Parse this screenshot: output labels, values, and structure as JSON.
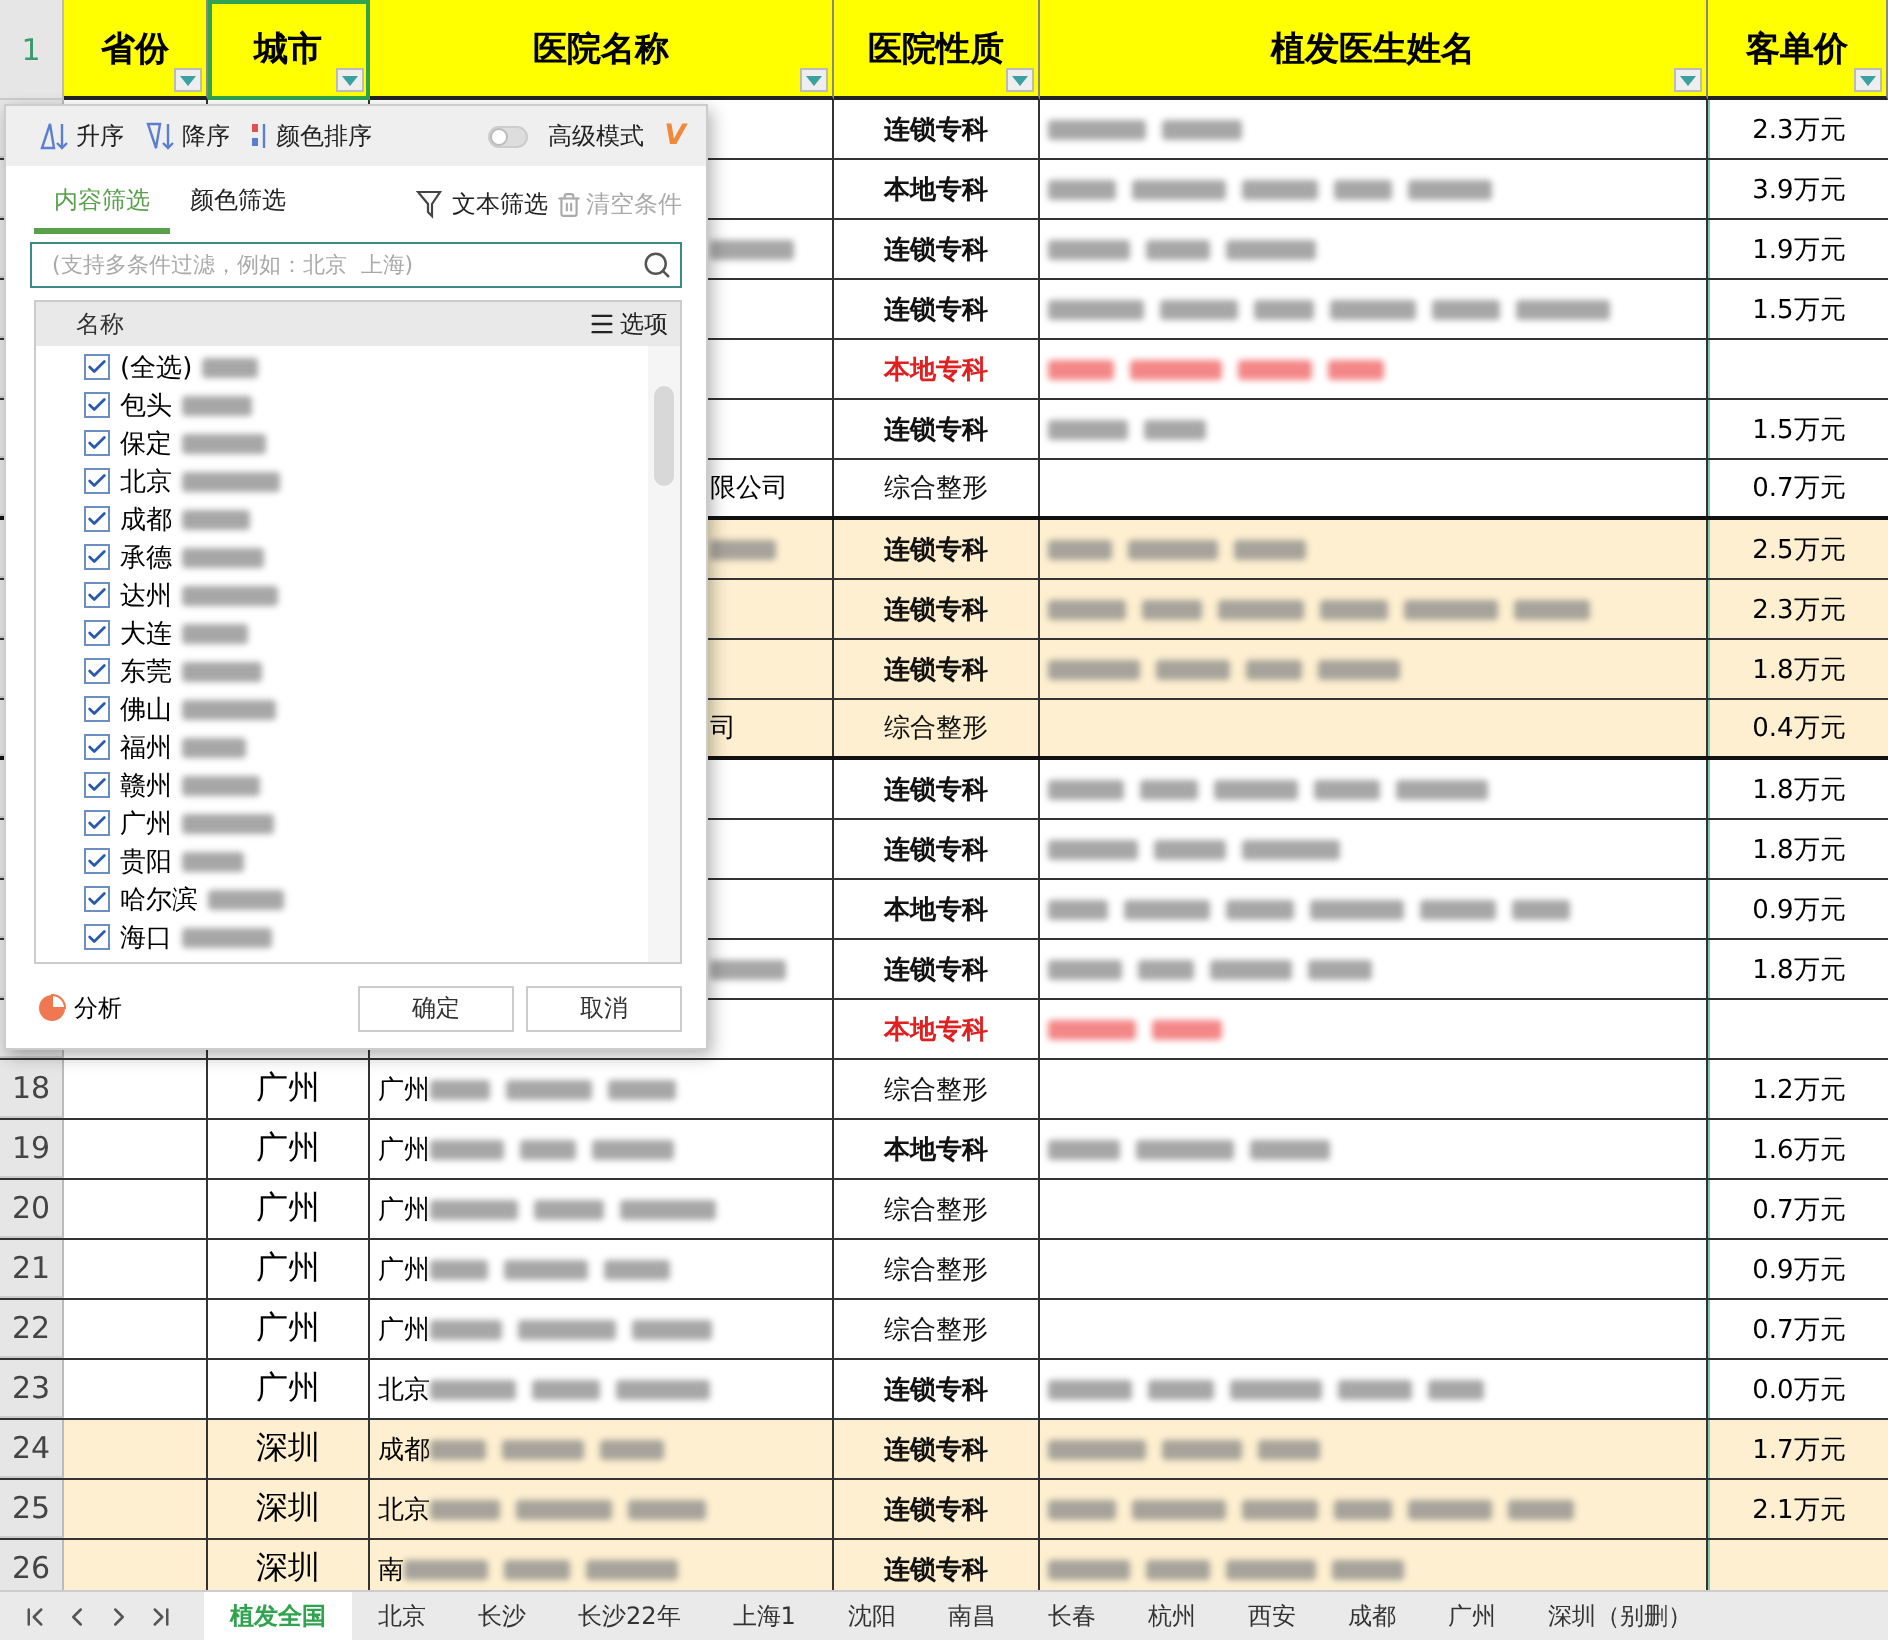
{
  "sheet": {
    "header_row": "1",
    "columns": [
      {
        "label": "省份",
        "selected": false
      },
      {
        "label": "城市",
        "selected": true
      },
      {
        "label": "医院名称",
        "selected": false
      },
      {
        "label": "医院性质",
        "selected": false
      },
      {
        "label": "植发医生姓名",
        "selected": false
      },
      {
        "label": "客单价",
        "selected": false
      }
    ],
    "rows": [
      {
        "nature": "连锁专科",
        "bold": true,
        "alert": false,
        "doctors_blurred": true,
        "price": "2.3万元",
        "shaded": false,
        "group_end": false
      },
      {
        "nature": "本地专科",
        "bold": true,
        "alert": false,
        "doctors_blurred": true,
        "price": "3.9万元",
        "shaded": false,
        "group_end": false
      },
      {
        "hospital_blurred": true,
        "nature": "连锁专科",
        "bold": true,
        "alert": false,
        "doctors_blurred": true,
        "price": "1.9万元",
        "shaded": false,
        "group_end": false
      },
      {
        "nature": "连锁专科",
        "bold": true,
        "alert": false,
        "doctors_blurred": true,
        "price": "1.5万元",
        "shaded": false,
        "group_end": false
      },
      {
        "nature": "本地专科",
        "bold": true,
        "alert": true,
        "doctors_blurred": true,
        "shaded": false,
        "group_end": false
      },
      {
        "nature": "连锁专科",
        "bold": true,
        "alert": false,
        "doctors_blurred": true,
        "price": "1.5万元",
        "shaded": false,
        "group_end": false
      },
      {
        "hospital": "限公司",
        "nature": "综合整形",
        "bold": false,
        "alert": false,
        "doctors_blurred": false,
        "price": "0.7万元",
        "shaded": false,
        "group_end": true
      },
      {
        "hospital_blurred": true,
        "nature": "连锁专科",
        "bold": true,
        "alert": false,
        "doctors_blurred": true,
        "price": "2.5万元",
        "shaded": true,
        "group_end": false
      },
      {
        "nature": "连锁专科",
        "bold": true,
        "alert": false,
        "doctors_blurred": true,
        "price": "2.3万元",
        "shaded": true,
        "group_end": false
      },
      {
        "nature": "连锁专科",
        "bold": true,
        "alert": false,
        "doctors_blurred": true,
        "price": "1.8万元",
        "shaded": true,
        "group_end": false
      },
      {
        "hospital": "司",
        "nature": "综合整形",
        "bold": false,
        "alert": false,
        "doctors_blurred": false,
        "price": "0.4万元",
        "shaded": true,
        "group_end": true
      },
      {
        "nature": "连锁专科",
        "bold": true,
        "alert": false,
        "doctors_blurred": true,
        "price": "1.8万元",
        "shaded": false,
        "group_end": false
      },
      {
        "nature": "连锁专科",
        "bold": true,
        "alert": false,
        "doctors_blurred": true,
        "price": "1.8万元",
        "shaded": false,
        "group_end": false
      },
      {
        "nature": "本地专科",
        "bold": true,
        "alert": false,
        "doctors_blurred": true,
        "price": "0.9万元",
        "shaded": false,
        "group_end": false
      },
      {
        "hospital_blurred": true,
        "nature": "连锁专科",
        "bold": true,
        "alert": false,
        "doctors_blurred": true,
        "price": "1.8万元",
        "shaded": false,
        "group_end": false
      },
      {
        "nature": "本地专科",
        "bold": true,
        "alert": true,
        "doctors_blurred": true,
        "shaded": false,
        "group_end": false
      },
      {
        "number": "18",
        "city": "广州",
        "hospital": "广州",
        "hospital_blurred": true,
        "nature": "综合整形",
        "bold": false,
        "alert": false,
        "doctors_blurred": false,
        "price": "1.2万元",
        "shaded": false,
        "group_end": false
      },
      {
        "number": "19",
        "city": "广州",
        "hospital": "广州",
        "hospital_blurred": true,
        "nature": "本地专科",
        "bold": true,
        "alert": false,
        "doctors_blurred": true,
        "price": "1.6万元",
        "shaded": false,
        "group_end": false
      },
      {
        "number": "20",
        "city": "广州",
        "hospital": "广州",
        "hospital_blurred": true,
        "nature": "综合整形",
        "bold": false,
        "alert": false,
        "doctors_blurred": false,
        "price": "0.7万元",
        "shaded": false,
        "group_end": false
      },
      {
        "number": "21",
        "city": "广州",
        "hospital": "广州",
        "hospital_blurred": true,
        "nature": "综合整形",
        "bold": false,
        "alert": false,
        "doctors_blurred": false,
        "price": "0.9万元",
        "shaded": false,
        "group_end": false
      },
      {
        "number": "22",
        "city": "广州",
        "hospital": "广州",
        "hospital_blurred": true,
        "nature": "综合整形",
        "bold": false,
        "alert": false,
        "doctors_blurred": false,
        "price": "0.7万元",
        "shaded": false,
        "group_end": false
      },
      {
        "number": "23",
        "city": "广州",
        "hospital": "北京",
        "hospital_blurred": true,
        "nature": "连锁专科",
        "bold": true,
        "alert": false,
        "doctors_blurred": true,
        "price": "0.0万元",
        "shaded": false,
        "group_end": false
      },
      {
        "number": "24",
        "city": "深圳",
        "hospital": "成都",
        "hospital_blurred": true,
        "nature": "连锁专科",
        "bold": true,
        "alert": false,
        "doctors_blurred": true,
        "price": "1.7万元",
        "shaded": true,
        "group_end": false
      },
      {
        "number": "25",
        "city": "深圳",
        "hospital": "北京",
        "hospital_blurred": true,
        "nature": "连锁专科",
        "bold": true,
        "alert": false,
        "doctors_blurred": true,
        "price": "2.1万元",
        "shaded": true,
        "group_end": false
      },
      {
        "number": "26",
        "city": "深圳",
        "hospital": "南",
        "hospital_blurred": true,
        "nature": "连锁专科",
        "bold": true,
        "alert": false,
        "doctors_blurred": true,
        "shaded": true,
        "group_end": false
      }
    ]
  },
  "filter_panel": {
    "sort_buttons": [
      {
        "label": "升序",
        "kind": "asc"
      },
      {
        "label": "降序",
        "kind": "desc"
      },
      {
        "label": "颜色排序",
        "kind": "color"
      }
    ],
    "advanced": {
      "label": "高级模式",
      "on": false
    },
    "vip_mark": "V",
    "tabs": [
      {
        "label": "内容筛选",
        "selected": true
      },
      {
        "label": "颜色筛选",
        "selected": false
      }
    ],
    "text_filter": "文本筛选",
    "clear": {
      "label": "清空条件",
      "disabled": true
    },
    "search": {
      "placeholder": "(支持多条件过滤，例如：北京  上海)"
    },
    "list_header": "名称",
    "options": "选项",
    "items": [
      {
        "label": "(全选)",
        "checked": true
      },
      {
        "label": "包头",
        "checked": true
      },
      {
        "label": "保定",
        "checked": true
      },
      {
        "label": "北京",
        "checked": true
      },
      {
        "label": "成都",
        "checked": true
      },
      {
        "label": "承德",
        "checked": true
      },
      {
        "label": "达州",
        "checked": true
      },
      {
        "label": "大连",
        "checked": true
      },
      {
        "label": "东莞",
        "checked": true
      },
      {
        "label": "佛山",
        "checked": true
      },
      {
        "label": "福州",
        "checked": true
      },
      {
        "label": "赣州",
        "checked": true
      },
      {
        "label": "广州",
        "checked": true
      },
      {
        "label": "贵阳",
        "checked": true
      },
      {
        "label": "哈尔滨",
        "checked": true
      },
      {
        "label": "海口",
        "checked": true
      }
    ],
    "analyze": "分析",
    "ok": "确定",
    "cancel": "取消"
  },
  "sheet_tabs": [
    {
      "label": "植发全国",
      "selected": true
    },
    {
      "label": "北京",
      "selected": false
    },
    {
      "label": "长沙",
      "selected": false
    },
    {
      "label": "长沙22年",
      "selected": false
    },
    {
      "label": "上海1",
      "selected": false
    },
    {
      "label": "沈阳",
      "selected": false
    },
    {
      "label": "南昌",
      "selected": false
    },
    {
      "label": "长春",
      "selected": false
    },
    {
      "label": "杭州",
      "selected": false
    },
    {
      "label": "西安",
      "selected": false
    },
    {
      "label": "成都",
      "selected": false
    },
    {
      "label": "广州",
      "selected": false
    },
    {
      "label": "深圳（别删）",
      "selected": false
    }
  ]
}
